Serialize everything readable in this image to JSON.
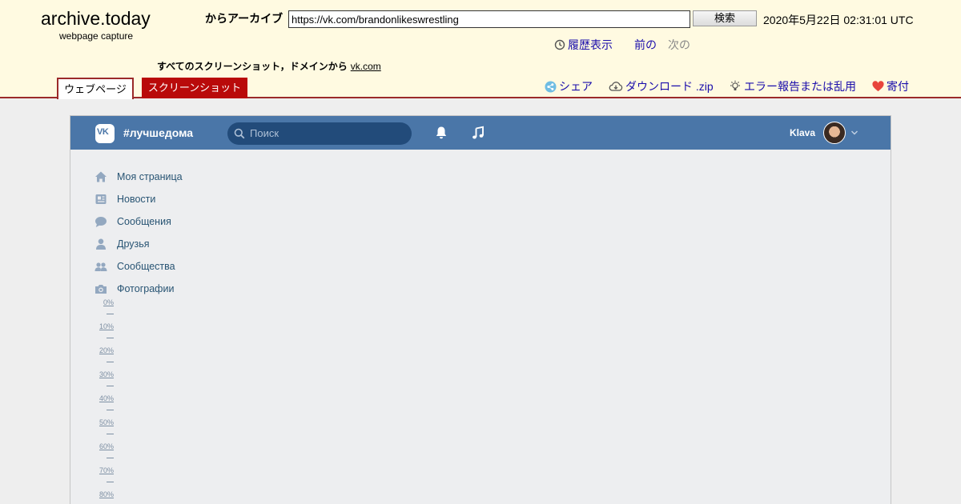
{
  "archive": {
    "logo": "archive.today",
    "logo_sub": "webpage capture",
    "from_label": "からアーカイブ",
    "url": "https://vk.com/brandonlikeswrestling",
    "search_button": "検索",
    "capture_date": "2020年5月22日 02:31:01 UTC",
    "history": "履歴表示",
    "prev": "前の",
    "next": "次の",
    "all_screenshots": "すべてのスクリーンショット，ドメインから",
    "domain": "vk.com",
    "tabs": {
      "webpage": "ウェブページ",
      "screenshot": "スクリーンショット"
    },
    "toolbar": {
      "share": "シェア",
      "download": "ダウンロード .zip",
      "report": "エラー報告または乱用",
      "donate": "寄付"
    }
  },
  "vk": {
    "logo": "VK",
    "brand": "#лучшедома",
    "search_placeholder": "Поиск",
    "user_name": "Klava",
    "menu": [
      {
        "label": "Моя страница",
        "icon": "home-icon"
      },
      {
        "label": "Новости",
        "icon": "news-icon"
      },
      {
        "label": "Сообщения",
        "icon": "messages-icon"
      },
      {
        "label": "Друзья",
        "icon": "friend-icon"
      },
      {
        "label": "Сообщества",
        "icon": "groups-icon"
      },
      {
        "label": "Фотографии",
        "icon": "camera-icon"
      }
    ],
    "loading_scale": [
      "0%",
      "10%",
      "20%",
      "30%",
      "40%",
      "50%",
      "60%",
      "70%",
      "80%"
    ]
  },
  "colors": {
    "archive_bg": "#fffae1",
    "archive_accent": "#9b2a2a",
    "screenshot_tab": "#b90a0a",
    "vk_header": "#4a76a8",
    "vk_search": "#224b7a",
    "vk_link": "#285473"
  }
}
